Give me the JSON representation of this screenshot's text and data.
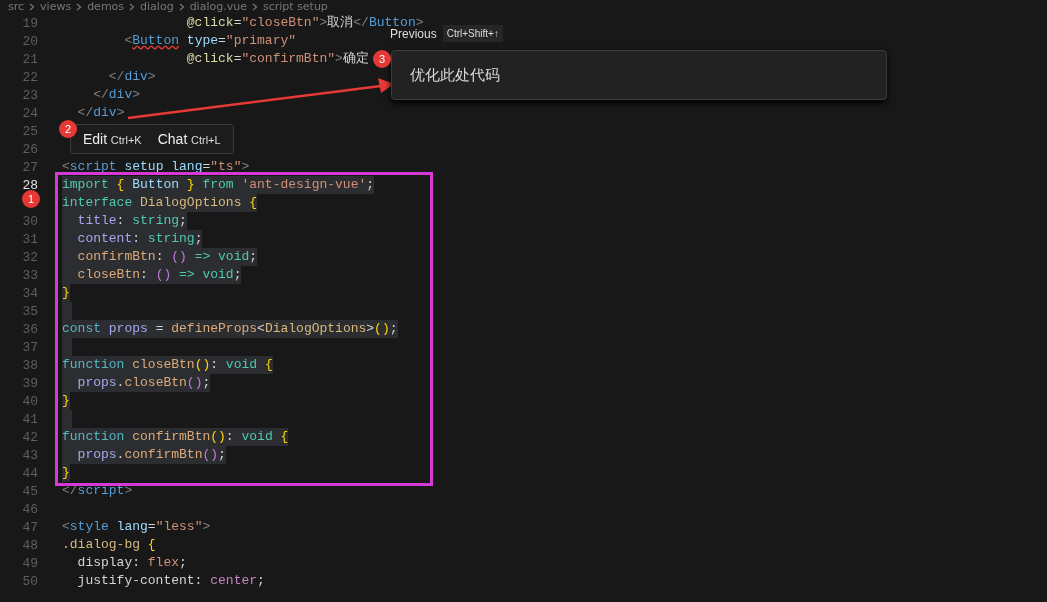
{
  "breadcrumb": [
    "src",
    "views",
    "demos",
    "dialog",
    "dialog.vue",
    "script setup"
  ],
  "lines": [
    {
      "number": "19",
      "active": false,
      "selected": false,
      "tokens": [
        {
          "kind": "attr",
          "text": "                @click"
        },
        {
          "kind": "plain",
          "text": "="
        },
        {
          "kind": "str",
          "text": "\"closeBtn\""
        },
        {
          "kind": "tag",
          "text": ">"
        },
        {
          "kind": "plain",
          "text": "取消"
        },
        {
          "kind": "tag",
          "text": "</"
        },
        {
          "kind": "tagname",
          "text": "Button"
        },
        {
          "kind": "tag",
          "text": ">"
        }
      ]
    },
    {
      "number": "20",
      "active": false,
      "selected": false,
      "tokens": [
        {
          "kind": "tag",
          "text": "        <"
        },
        {
          "kind": "error",
          "text": "Button"
        },
        {
          "kind": "prop2",
          "text": " type"
        },
        {
          "kind": "plain",
          "text": "="
        },
        {
          "kind": "str",
          "text": "\"primary\""
        }
      ]
    },
    {
      "number": "21",
      "active": false,
      "selected": false,
      "tokens": [
        {
          "kind": "attr",
          "text": "                @click"
        },
        {
          "kind": "plain",
          "text": "="
        },
        {
          "kind": "str",
          "text": "\"confirmBtn\""
        },
        {
          "kind": "tag",
          "text": ">"
        },
        {
          "kind": "plain",
          "text": "确定"
        }
      ]
    },
    {
      "number": "22",
      "active": false,
      "selected": false,
      "tokens": [
        {
          "kind": "tag",
          "text": "      </"
        },
        {
          "kind": "tagname",
          "text": "div"
        },
        {
          "kind": "tag",
          "text": ">"
        }
      ]
    },
    {
      "number": "23",
      "active": false,
      "selected": false,
      "tokens": [
        {
          "kind": "tag",
          "text": "    </"
        },
        {
          "kind": "tagname",
          "text": "div"
        },
        {
          "kind": "tag",
          "text": ">"
        }
      ]
    },
    {
      "number": "24",
      "active": false,
      "selected": false,
      "tokens": [
        {
          "kind": "tag",
          "text": "  </"
        },
        {
          "kind": "tagname",
          "text": "div"
        },
        {
          "kind": "tag",
          "text": ">"
        }
      ]
    },
    {
      "number": "25",
      "active": false,
      "selected": false
    },
    {
      "number": "26",
      "active": false,
      "selected": false
    },
    {
      "number": "27",
      "active": false,
      "selected": false,
      "tokens": [
        {
          "kind": "tag",
          "text": "<"
        },
        {
          "kind": "tagname",
          "text": "script"
        },
        {
          "kind": "prop2",
          "text": " setup"
        },
        {
          "kind": "prop2",
          "text": " lang"
        },
        {
          "kind": "plain",
          "text": "="
        },
        {
          "kind": "str",
          "text": "\"ts\""
        },
        {
          "kind": "tag",
          "text": ">"
        }
      ]
    },
    {
      "number": "28",
      "active": true,
      "selected": true,
      "tokens": [
        {
          "kind": "kw",
          "text": "import"
        },
        {
          "kind": "brace",
          "text": " {"
        },
        {
          "kind": "ident",
          "text": " Button"
        },
        {
          "kind": "brace",
          "text": " }"
        },
        {
          "kind": "kw",
          "text": " from"
        },
        {
          "kind": "str",
          "text": " 'ant-design-vue'"
        },
        {
          "kind": "plain",
          "text": ";"
        }
      ]
    },
    {
      "selected": true,
      "tokens": [
        {
          "kind": "kw",
          "text": "interface"
        },
        {
          "kind": "type",
          "text": " DialogOptions"
        },
        {
          "kind": "brace",
          "text": " {"
        }
      ]
    },
    {
      "number": "30",
      "active": false,
      "selected": true,
      "tokens": [
        {
          "kind": "prop",
          "text": "  title"
        },
        {
          "kind": "plain",
          "text": ":"
        },
        {
          "kind": "kw",
          "text": " string"
        },
        {
          "kind": "plain",
          "text": ";"
        }
      ]
    },
    {
      "number": "31",
      "active": false,
      "selected": true,
      "tokens": [
        {
          "kind": "prop",
          "text": "  content"
        },
        {
          "kind": "plain",
          "text": ":"
        },
        {
          "kind": "kw",
          "text": " string"
        },
        {
          "kind": "plain",
          "text": ";"
        }
      ]
    },
    {
      "number": "32",
      "active": false,
      "selected": true,
      "tokens": [
        {
          "kind": "method",
          "text": "  confirmBtn"
        },
        {
          "kind": "plain",
          "text": ":"
        },
        {
          "kind": "paren",
          "text": " ()"
        },
        {
          "kind": "kw",
          "text": " =>"
        },
        {
          "kind": "kw",
          "text": " void"
        },
        {
          "kind": "plain",
          "text": ";"
        }
      ]
    },
    {
      "number": "33",
      "active": false,
      "selected": true,
      "tokens": [
        {
          "kind": "method",
          "text": "  closeBtn"
        },
        {
          "kind": "plain",
          "text": ":"
        },
        {
          "kind": "paren",
          "text": " ()"
        },
        {
          "kind": "kw",
          "text": " =>"
        },
        {
          "kind": "kw",
          "text": " void"
        },
        {
          "kind": "plain",
          "text": ";"
        }
      ]
    },
    {
      "number": "34",
      "active": false,
      "selected": true,
      "tokens": [
        {
          "kind": "brace",
          "text": "}"
        }
      ]
    },
    {
      "number": "35",
      "active": false,
      "selected": true
    },
    {
      "number": "36",
      "active": false,
      "selected": true,
      "tokens": [
        {
          "kind": "kw2",
          "text": "const"
        },
        {
          "kind": "prop",
          "text": " props"
        },
        {
          "kind": "plain",
          "text": " ="
        },
        {
          "kind": "method",
          "text": " defineProps"
        },
        {
          "kind": "plain",
          "text": "<"
        },
        {
          "kind": "type",
          "text": "DialogOptions"
        },
        {
          "kind": "plain",
          "text": ">"
        },
        {
          "kind": "brace",
          "text": "()"
        },
        {
          "kind": "plain",
          "text": ";"
        }
      ]
    },
    {
      "number": "37",
      "active": false,
      "selected": true
    },
    {
      "number": "38",
      "active": false,
      "selected": true,
      "tokens": [
        {
          "kind": "kw2",
          "text": "function"
        },
        {
          "kind": "method",
          "text": " closeBtn"
        },
        {
          "kind": "brace",
          "text": "()"
        },
        {
          "kind": "plain",
          "text": ":"
        },
        {
          "kind": "kw",
          "text": " void"
        },
        {
          "kind": "brace",
          "text": " {"
        }
      ]
    },
    {
      "number": "39",
      "active": false,
      "selected": true,
      "tokens": [
        {
          "kind": "prop",
          "text": "  props"
        },
        {
          "kind": "plain",
          "text": "."
        },
        {
          "kind": "method",
          "text": "closeBtn"
        },
        {
          "kind": "paren",
          "text": "()"
        },
        {
          "kind": "plain",
          "text": ";"
        }
      ]
    },
    {
      "number": "40",
      "active": false,
      "selected": true,
      "tokens": [
        {
          "kind": "brace",
          "text": "}"
        }
      ]
    },
    {
      "number": "41",
      "active": false,
      "selected": true
    },
    {
      "number": "42",
      "active": false,
      "selected": true,
      "tokens": [
        {
          "kind": "kw2",
          "text": "function"
        },
        {
          "kind": "method",
          "text": " confirmBtn"
        },
        {
          "kind": "brace",
          "text": "()"
        },
        {
          "kind": "plain",
          "text": ":"
        },
        {
          "kind": "kw",
          "text": " void"
        },
        {
          "kind": "brace",
          "text": " {"
        }
      ]
    },
    {
      "number": "43",
      "active": false,
      "selected": true,
      "tokens": [
        {
          "kind": "prop",
          "text": "  props"
        },
        {
          "kind": "plain",
          "text": "."
        },
        {
          "kind": "method",
          "text": "confirmBtn"
        },
        {
          "kind": "paren",
          "text": "()"
        },
        {
          "kind": "plain",
          "text": ";"
        }
      ]
    },
    {
      "number": "44",
      "active": false,
      "selected": true,
      "tokens": [
        {
          "kind": "brace",
          "text": "}"
        }
      ]
    },
    {
      "number": "45",
      "active": false,
      "selected": false,
      "tokens": [
        {
          "kind": "tag",
          "text": "</"
        },
        {
          "kind": "tagname",
          "text": "script"
        },
        {
          "kind": "tag",
          "text": ">"
        }
      ]
    },
    {
      "number": "46",
      "active": false,
      "selected": false
    },
    {
      "number": "47",
      "active": false,
      "selected": false,
      "tokens": [
        {
          "kind": "tag",
          "text": "<"
        },
        {
          "kind": "tagname",
          "text": "style"
        },
        {
          "kind": "prop2",
          "text": " lang"
        },
        {
          "kind": "plain",
          "text": "="
        },
        {
          "kind": "str",
          "text": "\"less\""
        },
        {
          "kind": "tag",
          "text": ">"
        }
      ]
    },
    {
      "number": "48",
      "active": false,
      "selected": false,
      "tokens": [
        {
          "kind": "selector",
          "text": ".dialog-bg"
        },
        {
          "kind": "brace",
          "text": " {"
        }
      ]
    },
    {
      "number": "49",
      "active": false,
      "selected": false,
      "tokens": [
        {
          "kind": "plain",
          "text": "  display:"
        },
        {
          "kind": "cssval",
          "text": " flex"
        },
        {
          "kind": "plain",
          "text": ";"
        }
      ]
    },
    {
      "number": "50",
      "active": false,
      "selected": false,
      "tokens": [
        {
          "kind": "plain",
          "text": "  justify-content:"
        },
        {
          "kind": "cssval2",
          "text": " center"
        },
        {
          "kind": "plain",
          "text": ";"
        }
      ]
    }
  ],
  "markers": [
    {
      "label": "1"
    },
    {
      "label": "2"
    },
    {
      "label": "3"
    }
  ],
  "inline_actions": [
    {
      "label": "Edit",
      "shortcut": "Ctrl+K"
    },
    {
      "label": "Chat",
      "shortcut": "Ctrl+L"
    }
  ],
  "previous_hint": {
    "label": "Previous",
    "shortcut": "Ctrl+Shift+↑"
  },
  "prompt_box": {
    "value": "优化此处代码"
  }
}
